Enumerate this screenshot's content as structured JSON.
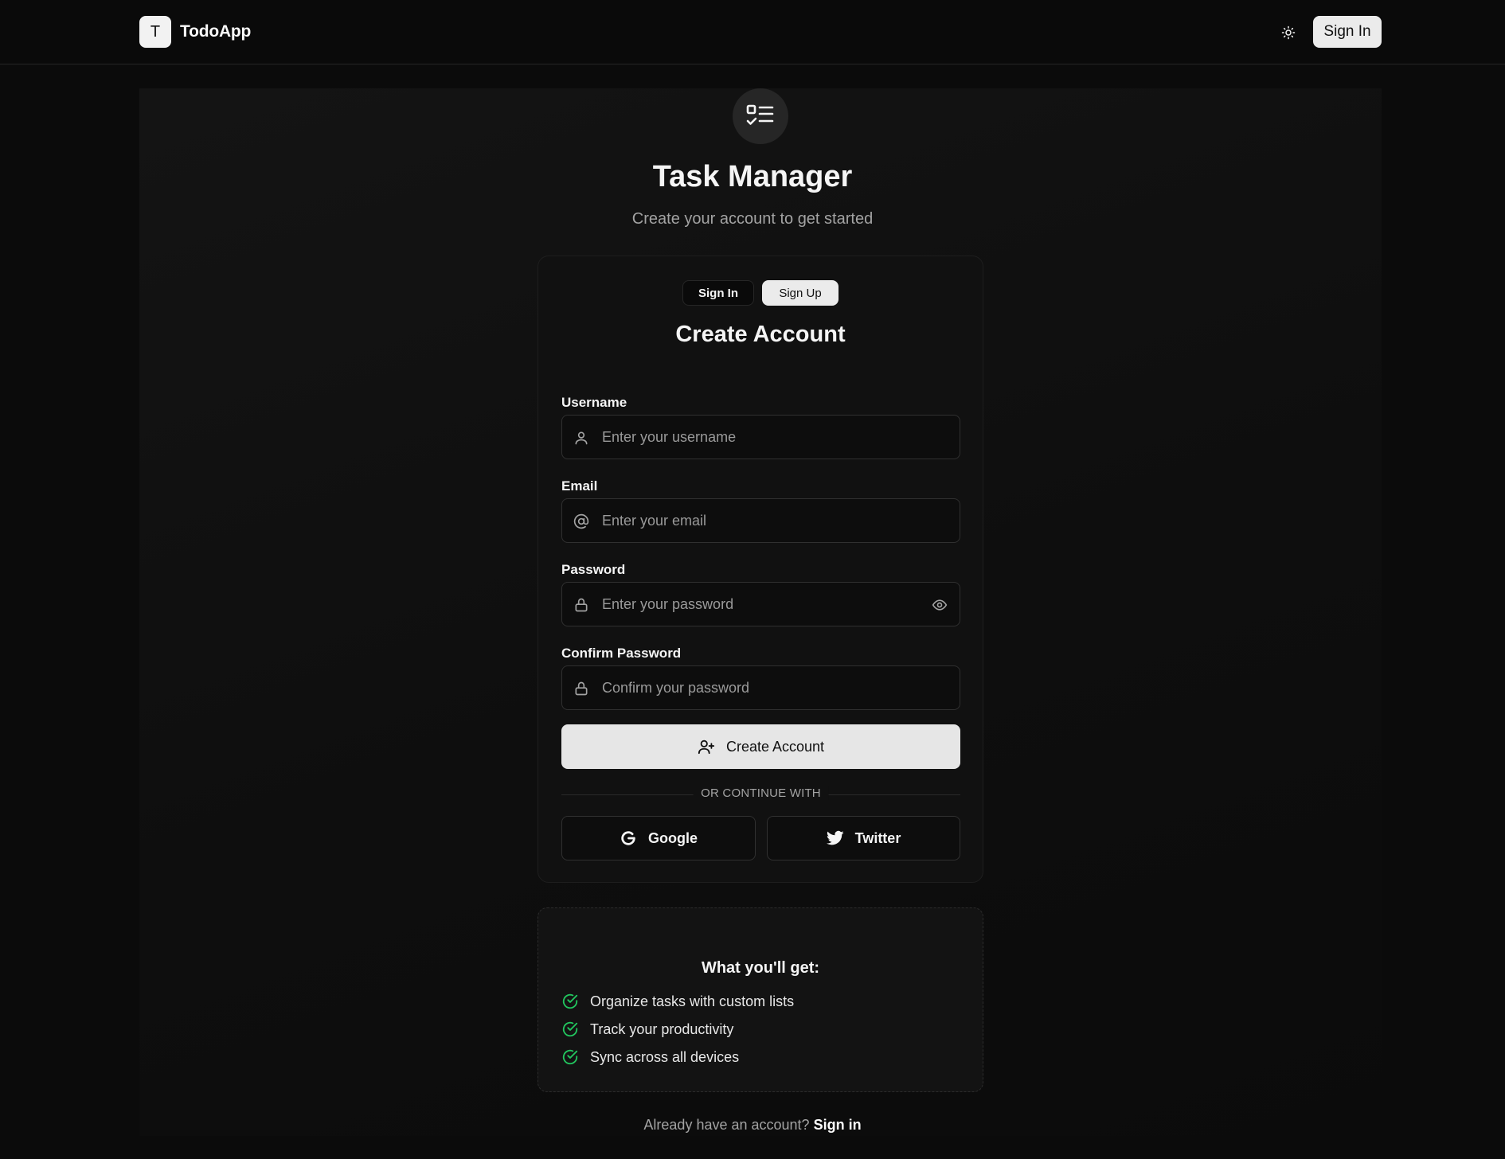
{
  "navbar": {
    "logo_letter": "T",
    "brand": "TodoApp",
    "theme_icon": "sun-icon",
    "signin_label": "Sign In"
  },
  "hero": {
    "icon": "checklist-icon",
    "title": "Task Manager",
    "subtitle": "Create your account to get started"
  },
  "auth_card": {
    "tabs": [
      {
        "label": "Sign In",
        "active": false
      },
      {
        "label": "Sign Up",
        "active": true
      }
    ],
    "title": "Create Account",
    "fields": {
      "username": {
        "label": "Username",
        "placeholder": "Enter your username",
        "value": "",
        "icon": "user-icon"
      },
      "email": {
        "label": "Email",
        "placeholder": "Enter your email",
        "value": "",
        "icon": "at-sign-icon"
      },
      "password": {
        "label": "Password",
        "placeholder": "Enter your password",
        "value": "",
        "icon": "lock-icon",
        "toggle_icon": "eye-icon"
      },
      "confirm_password": {
        "label": "Confirm Password",
        "placeholder": "Confirm your password",
        "value": "",
        "icon": "lock-icon"
      }
    },
    "submit_label": "Create Account",
    "submit_icon": "user-plus-icon",
    "divider_text": "OR CONTINUE WITH",
    "social": {
      "google_label": "Google",
      "twitter_label": "Twitter"
    }
  },
  "benefits": {
    "title": "What you'll get:",
    "items": [
      "Organize tasks with custom lists",
      "Track your productivity",
      "Sync across all devices"
    ],
    "check_color": "#22c55e"
  },
  "footer": {
    "prompt": "Already have an account?",
    "link": "Sign in"
  }
}
